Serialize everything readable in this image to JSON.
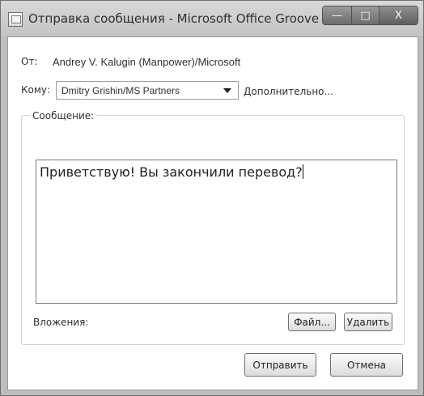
{
  "window": {
    "title": "Отправка сообщения - Microsoft Office Groove"
  },
  "form": {
    "from_label": "От:",
    "from_value": "Andrey V. Kalugin (Manpower)/Microsoft",
    "to_label": "Кому:",
    "to_value": "Dmitry Grishin/MS Partners",
    "more_label": "Дополнительно..."
  },
  "message": {
    "group_label": "Сообщение:",
    "text": "Приветствую! Вы закончили перевод?"
  },
  "attachments": {
    "label": "Вложения:",
    "file_button": "Файл...",
    "delete_button": "Удалить"
  },
  "actions": {
    "send": "Отправить",
    "cancel": "Отмена"
  },
  "title_buttons": {
    "minimize": "—",
    "maximize": "□",
    "close": "X"
  }
}
